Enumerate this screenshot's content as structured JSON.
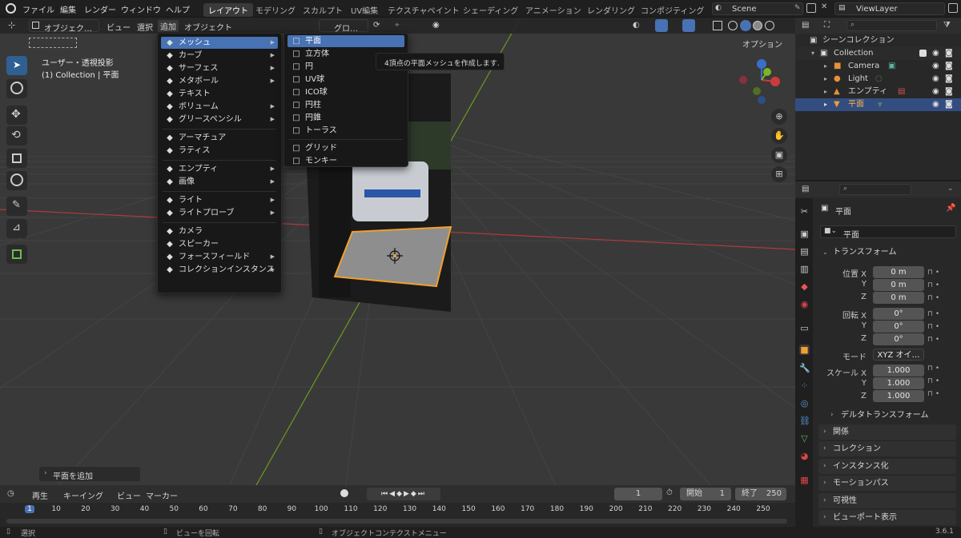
{
  "topbar": {
    "menus": [
      "ファイル",
      "編集",
      "レンダー",
      "ウィンドウ",
      "ヘルプ"
    ],
    "workspaces": [
      "レイアウト",
      "モデリング",
      "スカルプト",
      "UV編集",
      "テクスチャペイント",
      "シェーディング",
      "アニメーション",
      "レンダリング",
      "コンポジティング"
    ],
    "scene": "Scene",
    "viewlayer": "ViewLayer"
  },
  "viewport_header": {
    "mode": "オブジェク…",
    "menus": [
      "ビュー",
      "選択",
      "追加",
      "オブジェクト"
    ],
    "orientation": "グロ…",
    "options": "オプション"
  },
  "viewport": {
    "view_name": "ユーザー・透視投影",
    "collection_info": "(1) Collection | 平面",
    "last_op": "平面を追加"
  },
  "add_menu": [
    {
      "label": "メッシュ",
      "icon": "mesh-icon",
      "sub": true
    },
    {
      "label": "カーブ",
      "icon": "curve-icon",
      "sub": true
    },
    {
      "label": "サーフェス",
      "icon": "surface-icon",
      "sub": true
    },
    {
      "label": "メタボール",
      "icon": "metaball-icon",
      "sub": true
    },
    {
      "label": "テキスト",
      "icon": "text-icon",
      "sub": false
    },
    {
      "label": "ボリューム",
      "icon": "volume-icon",
      "sub": true
    },
    {
      "label": "グリースペンシル",
      "icon": "grease-pencil-icon",
      "sub": true
    },
    {
      "label": "アーマチュア",
      "icon": "armature-icon",
      "sub": false
    },
    {
      "label": "ラティス",
      "icon": "lattice-icon",
      "sub": false
    },
    {
      "label": "エンプティ",
      "icon": "empty-icon",
      "sub": true
    },
    {
      "label": "画像",
      "icon": "image-icon",
      "sub": true
    },
    {
      "label": "ライト",
      "icon": "light-icon",
      "sub": true
    },
    {
      "label": "ライトプローブ",
      "icon": "light-probe-icon",
      "sub": true
    },
    {
      "label": "カメラ",
      "icon": "camera-icon",
      "sub": false
    },
    {
      "label": "スピーカー",
      "icon": "speaker-icon",
      "sub": false
    },
    {
      "label": "フォースフィールド",
      "icon": "force-field-icon",
      "sub": true
    },
    {
      "label": "コレクションインスタンス",
      "icon": "collection-instance-icon",
      "sub": true
    }
  ],
  "mesh_menu": [
    {
      "label": "平面",
      "icon": "plane-icon"
    },
    {
      "label": "立方体",
      "icon": "cube-icon"
    },
    {
      "label": "円",
      "icon": "circle-icon"
    },
    {
      "label": "UV球",
      "icon": "uv-sphere-icon"
    },
    {
      "label": "ICO球",
      "icon": "ico-sphere-icon"
    },
    {
      "label": "円柱",
      "icon": "cylinder-icon"
    },
    {
      "label": "円錐",
      "icon": "cone-icon"
    },
    {
      "label": "トーラス",
      "icon": "torus-icon"
    },
    {
      "label": "グリッド",
      "icon": "grid-icon"
    },
    {
      "label": "モンキー",
      "icon": "monkey-icon"
    }
  ],
  "tooltip": "4頂点の平面メッシュを作成します.",
  "outliner": {
    "root": "シーンコレクション",
    "items": [
      {
        "label": "Collection"
      },
      {
        "label": "Camera"
      },
      {
        "label": "Light"
      },
      {
        "label": "エンプティ"
      },
      {
        "label": "平面"
      }
    ]
  },
  "properties": {
    "object_name": "平面",
    "data_name": "平面",
    "transform_header": "トランスフォーム",
    "location_label": "位置",
    "rotation_label": "回転",
    "mode_label": "モード",
    "mode_value": "XYZ オイ…",
    "scale_label": "スケール",
    "axes": [
      "X",
      "Y",
      "Z"
    ],
    "location": [
      "0 m",
      "0 m",
      "0 m"
    ],
    "rotation": [
      "0°",
      "0°",
      "0°"
    ],
    "scale": [
      "1.000",
      "1.000",
      "1.000"
    ],
    "delta": "デルタトランスフォーム",
    "sections": [
      "関係",
      "コレクション",
      "インスタンス化",
      "モーションパス",
      "可視性",
      "ビューポート表示"
    ]
  },
  "timeline": {
    "menus": [
      "再生",
      "キーイング",
      "ビュー",
      "マーカー"
    ],
    "current": "1",
    "start_label": "開始",
    "start": "1",
    "end_label": "終了",
    "end": "250",
    "ticks": [
      "1",
      "10",
      "20",
      "30",
      "40",
      "50",
      "60",
      "70",
      "80",
      "90",
      "100",
      "110",
      "120",
      "130",
      "140",
      "150",
      "160",
      "170",
      "180",
      "190",
      "200",
      "210",
      "220",
      "230",
      "240",
      "250"
    ]
  },
  "status": {
    "select": "選択",
    "rotate": "ビューを回転",
    "context": "オブジェクトコンテクストメニュー",
    "version": "3.6.1"
  },
  "colors": {
    "accent": "#4772b3",
    "selection": "#f29f2e",
    "x_axis": "#cc3b3b",
    "y_axis": "#7bb424"
  }
}
